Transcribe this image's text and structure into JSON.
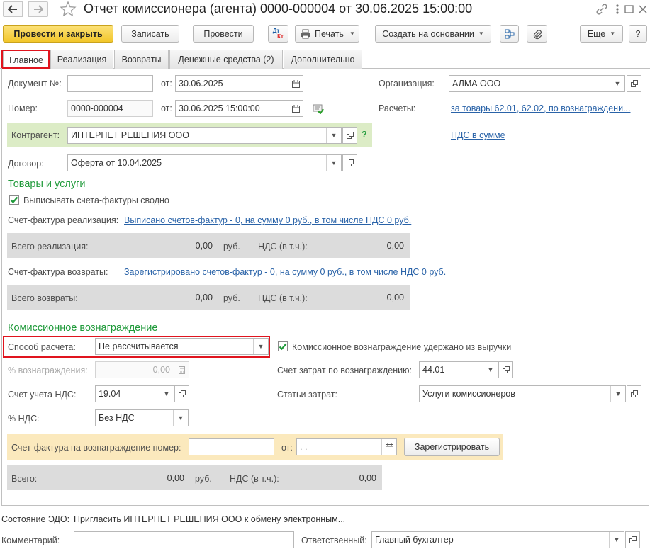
{
  "title": "Отчет комиссионера (агента) 0000-000004 от 30.06.2025 15:00:00",
  "toolbar": {
    "post_close": "Провести и закрыть",
    "save": "Записать",
    "post": "Провести",
    "dtkt_top": "Дт",
    "dtkt_bottom": "Кт",
    "print": "Печать",
    "create_based": "Создать на основании",
    "more": "Еще",
    "help": "?"
  },
  "tabs": [
    "Главное",
    "Реализация",
    "Возвраты",
    "Денежные средства (2)",
    "Дополнительно"
  ],
  "form": {
    "doc_no_label": "Документ №:",
    "doc_no_value": "",
    "from_label": "от:",
    "doc_date": "30.06.2025",
    "number_label": "Номер:",
    "number_value": "0000-000004",
    "number_date": "30.06.2025 15:00:00",
    "org_label": "Организация:",
    "org_value": "АЛМА ООО",
    "settlements_label": "Расчеты:",
    "settlements_link": "за товары 62.01, 62.02, по вознаграждени...",
    "vat_link": "НДС в сумме",
    "counterparty_label": "Контрагент:",
    "counterparty_value": "ИНТЕРНЕТ РЕШЕНИЯ ООО",
    "help_q": "?",
    "contract_label": "Договор:",
    "contract_value": "Оферта от 10.04.2025"
  },
  "goods": {
    "title": "Товары и услуги",
    "consolidated_invoice": "Выписывать счета-фактуры сводно",
    "invoice_sales_label": "Счет-фактура реализация:",
    "invoice_sales_link": "Выписано счетов-фактур - 0, на сумму 0 руб., в том числе НДС 0 руб.",
    "total_sales_label": "Всего реализация:",
    "total_sales_value": "0,00",
    "rub": "руб.",
    "vat_incl_label": "НДС (в т.ч.):",
    "total_sales_vat": "0,00",
    "invoice_returns_label": "Счет-фактура возвраты:",
    "invoice_returns_link": "Зарегистрировано счетов-фактур - 0, на сумму 0 руб., в том числе НДС 0 руб.",
    "total_returns_label": "Всего возвраты:",
    "total_returns_value": "0,00",
    "total_returns_vat": "0,00"
  },
  "commission": {
    "title": "Комиссионное вознаграждение",
    "calc_method_label": "Способ расчета:",
    "calc_method_value": "Не рассчитывается",
    "withheld_label": "Комиссионное вознаграждение удержано из выручки",
    "percent_label": "% вознаграждения:",
    "percent_value": "0,00",
    "cost_account_label": "Счет затрат по вознаграждению:",
    "cost_account_value": "44.01",
    "vat_account_label": "Счет учета НДС:",
    "vat_account_value": "19.04",
    "cost_items_label": "Статьи затрат:",
    "cost_items_value": "Услуги комиссионеров",
    "vat_rate_label": "% НДС:",
    "vat_rate_value": "Без НДС",
    "invoice_no_label": "Счет-фактура на вознаграждение номер:",
    "invoice_no_value": "",
    "invoice_from_label": "от:",
    "invoice_date_value": " .  .",
    "register_button": "Зарегистрировать",
    "total_label": "Всего:",
    "total_value": "0,00",
    "rub": "руб.",
    "vat_incl_label": "НДС (в т.ч.):",
    "total_vat": "0,00"
  },
  "footer": {
    "edo_label": "Состояние ЭДО:",
    "edo_value": "Пригласить ИНТЕРНЕТ РЕШЕНИЯ ООО к обмену электронным...",
    "comment_label": "Комментарий:",
    "comment_value": "",
    "responsible_label": "Ответственный:",
    "responsible_value": "Главный бухгалтер"
  },
  "colors": {
    "accent_button": "#f5d23c",
    "link": "#2a63a8",
    "section_title": "#1f9a3a",
    "counterparty_bg": "#dcecc6",
    "invoice_bg": "#fbe9bd",
    "total_panel": "#dcdcdc",
    "highlight": "#e0141e"
  }
}
